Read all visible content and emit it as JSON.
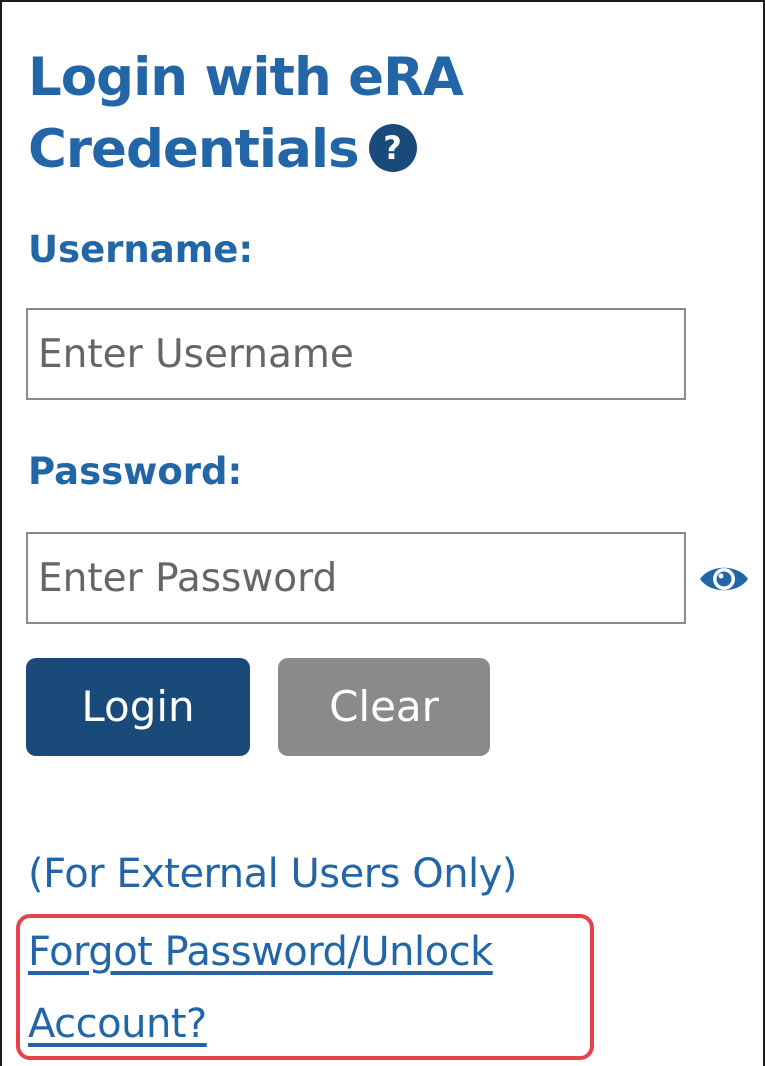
{
  "login": {
    "title_line1": "Login with eRA",
    "title_line2": "Credentials",
    "help_icon_glyph": "?",
    "username_label": "Username:",
    "username_placeholder": "Enter Username",
    "password_label": "Password:",
    "password_placeholder": "Enter Password",
    "show_password_icon": "eye-icon",
    "login_button": "Login",
    "clear_button": "Clear",
    "external_note": "(For External Users Only)",
    "forgot_line1": "Forgot Password/Unlock",
    "forgot_line2": "Account?"
  },
  "colors": {
    "primary_blue": "#2266a8",
    "dark_blue": "#1a4a7a",
    "clear_gray": "#8a8a8a",
    "highlight_red": "#e8414b"
  }
}
